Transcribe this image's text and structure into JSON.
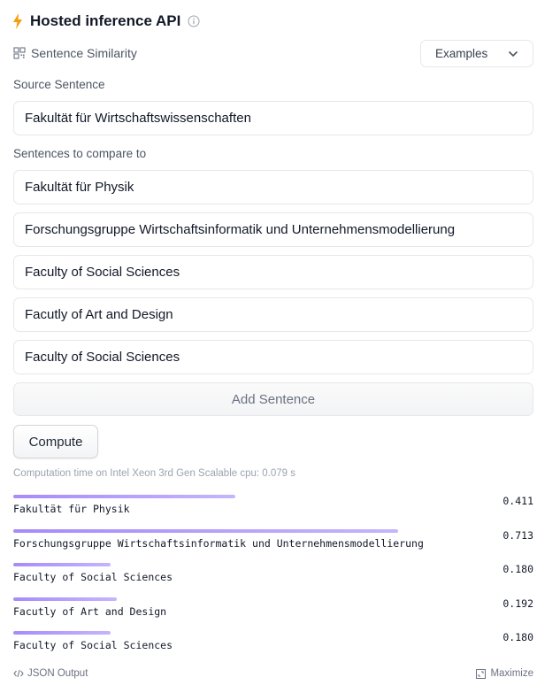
{
  "header": {
    "title": "Hosted inference API",
    "bolt_color": "#f59e0b"
  },
  "task": {
    "label": "Sentence Similarity"
  },
  "examples": {
    "label": "Examples"
  },
  "source": {
    "label": "Source Sentence",
    "value": "Fakultät für Wirtschaftswissenschaften"
  },
  "compare": {
    "label": "Sentences to compare to",
    "sentences": [
      "Fakultät für Physik",
      "Forschungsgruppe Wirtschaftsinformatik und Unternehmensmodellierung",
      "Faculty of Social Sciences",
      "Facutly of Art and Design",
      "Faculty of Social Sciences"
    ]
  },
  "buttons": {
    "add_sentence": "Add Sentence",
    "compute": "Compute"
  },
  "computation_time": "Computation time on Intel Xeon 3rd Gen Scalable cpu: 0.079 s",
  "results": [
    {
      "label": "Fakultät für Physik",
      "score": "0.411",
      "value": 0.411
    },
    {
      "label": "Forschungsgruppe Wirtschaftsinformatik und Unternehmensmodellierung",
      "score": "0.713",
      "value": 0.713
    },
    {
      "label": "Faculty of Social Sciences",
      "score": "0.180",
      "value": 0.18
    },
    {
      "label": "Facutly of Art and Design",
      "score": "0.192",
      "value": 0.192
    },
    {
      "label": "Faculty of Social Sciences",
      "score": "0.180",
      "value": 0.18
    }
  ],
  "footer": {
    "json_output": "JSON Output",
    "maximize": "Maximize"
  }
}
